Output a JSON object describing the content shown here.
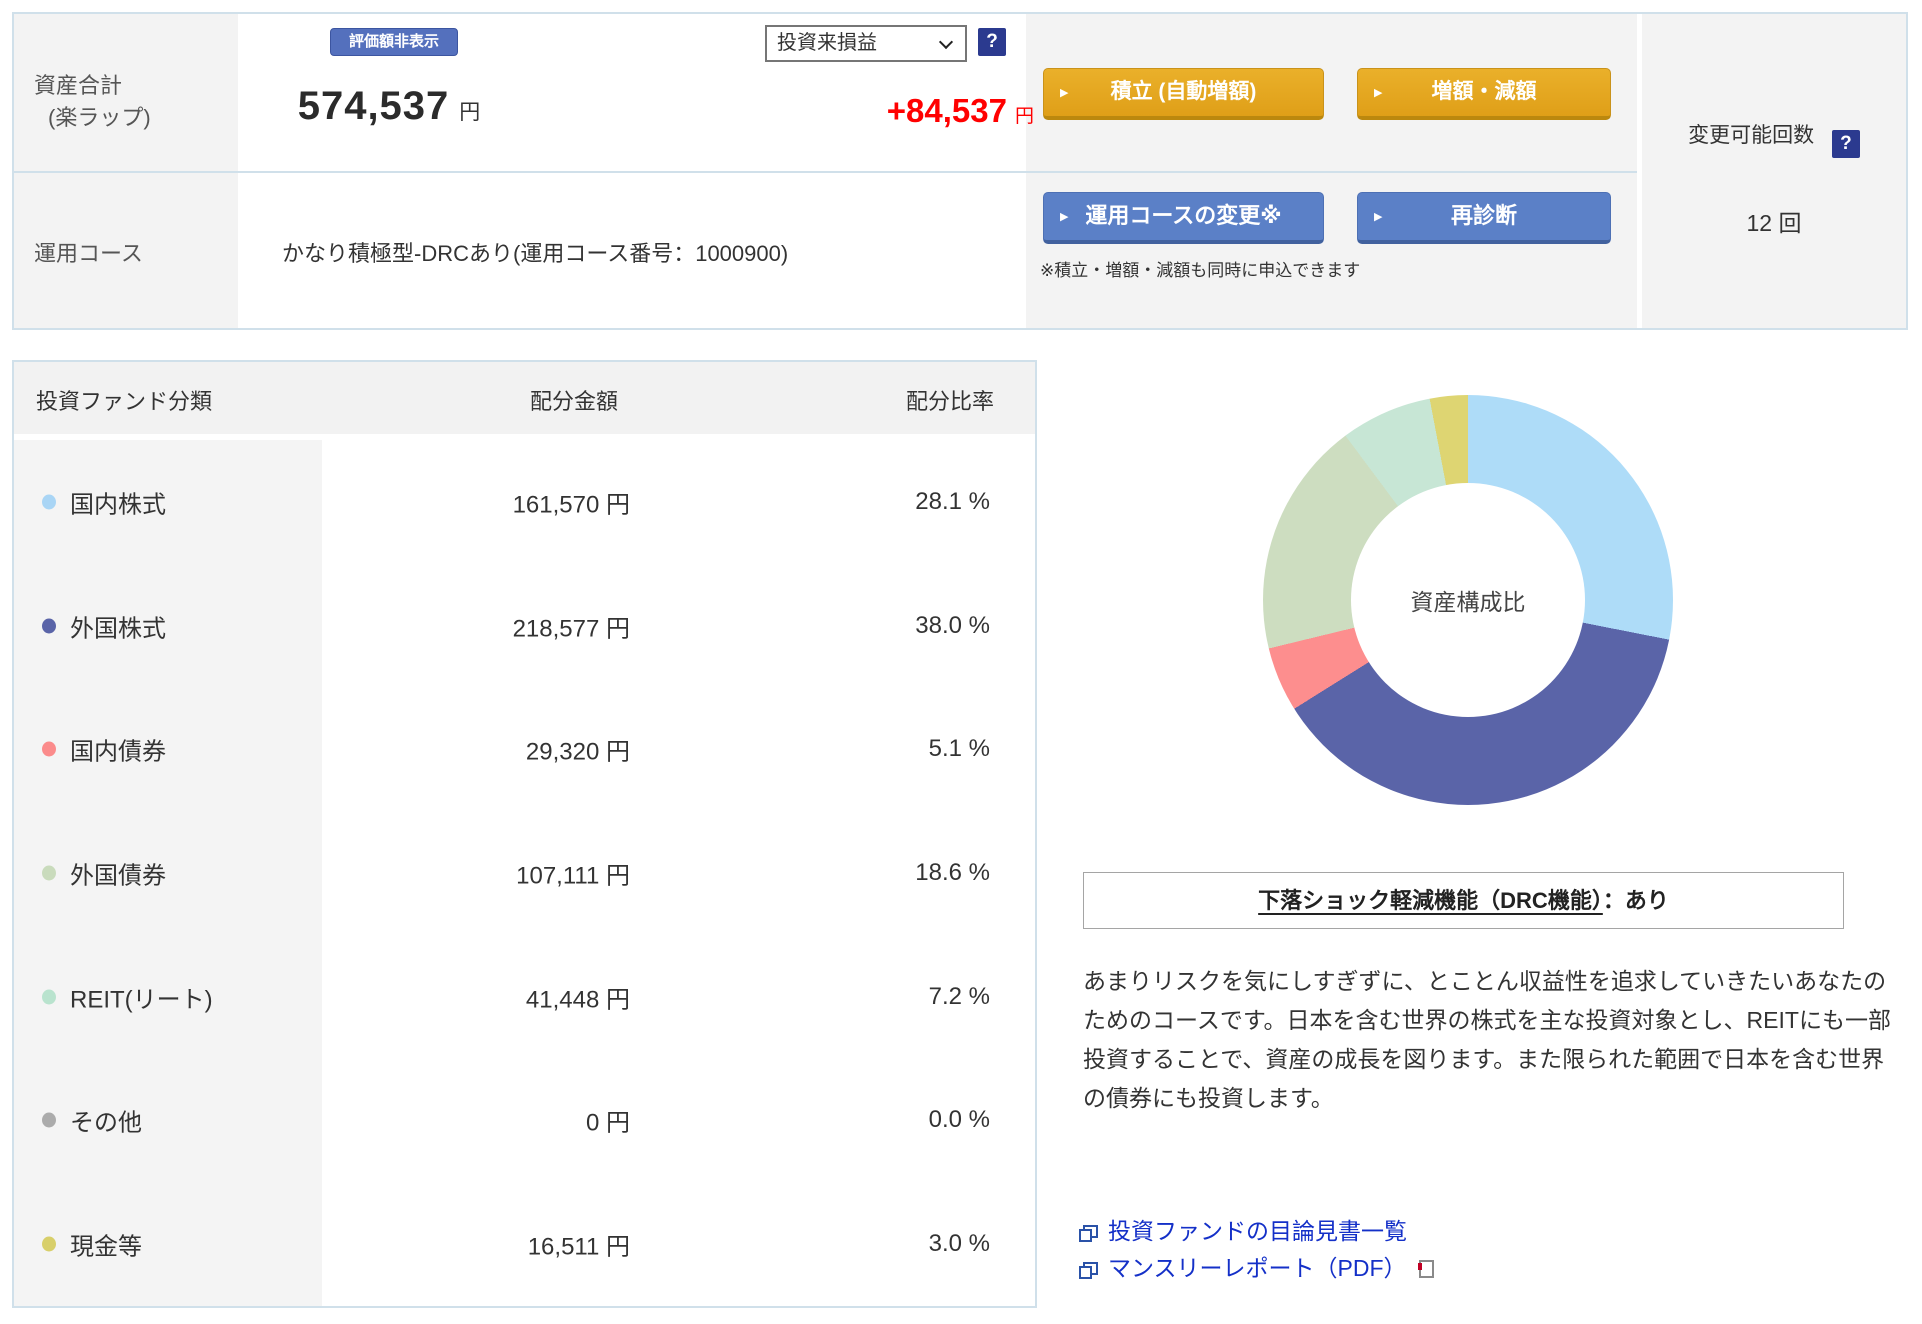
{
  "summary": {
    "asset_label_line1": "資産合計",
    "asset_label_line2": "(楽ラップ)",
    "hide_button": "評価額非表示",
    "total_amount": "574,537",
    "total_unit": "円",
    "pl_select_value": "投資来損益",
    "help_icon": "?",
    "pl_amount": "+84,537",
    "pl_unit": "円",
    "buttons": {
      "tsumitate": "積立 (自動増額)",
      "zogen": "増額・減額",
      "course_change": "運用コースの変更※",
      "rediagnosis": "再診断"
    },
    "course_label": "運用コース",
    "course_value": "かなり積極型-DRCあり(運用コース番号：1000900)",
    "note": "※積立・増額・減額も同時に申込できます",
    "change_count": {
      "label": "変更可能回数",
      "value": "12 回",
      "help_icon": "?"
    }
  },
  "colors": {
    "accent_orange": "#e2a41c",
    "button_blue": "#5b80c7",
    "hide_button_blue": "#5470bd",
    "help_icon_navy": "#2b3a8f",
    "pl_red": "#ff0000",
    "panel_border": "#d0e0ea",
    "link_blue": "#1430c8"
  },
  "allocation_table": {
    "headers": [
      "投資ファンド分類",
      "配分金額",
      "配分比率"
    ],
    "rows": [
      {
        "label": "国内株式",
        "amount": "161,570 円",
        "ratio": "28.1 %",
        "color": "#a9d5f5"
      },
      {
        "label": "外国株式",
        "amount": "218,577 円",
        "ratio": "38.0 %",
        "color": "#5a64a8"
      },
      {
        "label": "国内債券",
        "amount": "29,320 円",
        "ratio": "5.1 %",
        "color": "#fb8b8b"
      },
      {
        "label": "外国債券",
        "amount": "107,111 円",
        "ratio": "18.6 %",
        "color": "#c9dbbc"
      },
      {
        "label": "REIT(リート)",
        "amount": "41,448 円",
        "ratio": "7.2 %",
        "color": "#b9e3ce"
      },
      {
        "label": "その他",
        "amount": "0 円",
        "ratio": "0.0 %",
        "color": "#ababab"
      },
      {
        "label": "現金等",
        "amount": "16,511 円",
        "ratio": "3.0 %",
        "color": "#d8cf6a"
      }
    ]
  },
  "chart_data": {
    "type": "pie",
    "subtype": "donut",
    "title": "資産構成比",
    "series": [
      {
        "name": "国内株式",
        "value": 28.1,
        "color": "#aedcf8"
      },
      {
        "name": "外国株式",
        "value": 38.0,
        "color": "#5a64a8"
      },
      {
        "name": "国内債券",
        "value": 5.1,
        "color": "#fd8e8e"
      },
      {
        "name": "外国債券",
        "value": 18.6,
        "color": "#cdddc0"
      },
      {
        "name": "REIT(リート)",
        "value": 7.2,
        "color": "#c7e6d5"
      },
      {
        "name": "その他",
        "value": 0.0,
        "color": "#ababab"
      },
      {
        "name": "現金等",
        "value": 3.0,
        "color": "#ded572"
      }
    ],
    "start_angle": 0,
    "direction": "clockwise",
    "inner_radius_ratio": 0.57,
    "legend_position": "none"
  },
  "drc_box": {
    "title": "下落ショック軽減機能（DRC機能）",
    "status": "：あり"
  },
  "course_description": "あまりリスクを気にしすぎずに、とことん収益性を追求していきたいあなたのためのコースです。日本を含む世界の株式を主な投資対象とし、REITにも一部投資することで、資産の成長を図ります。また限られた範囲で日本を含む世界の債券にも投資します。",
  "links": [
    {
      "label": "投資ファンドの目論見書一覧"
    },
    {
      "label": "マンスリーレポート（PDF）"
    }
  ]
}
